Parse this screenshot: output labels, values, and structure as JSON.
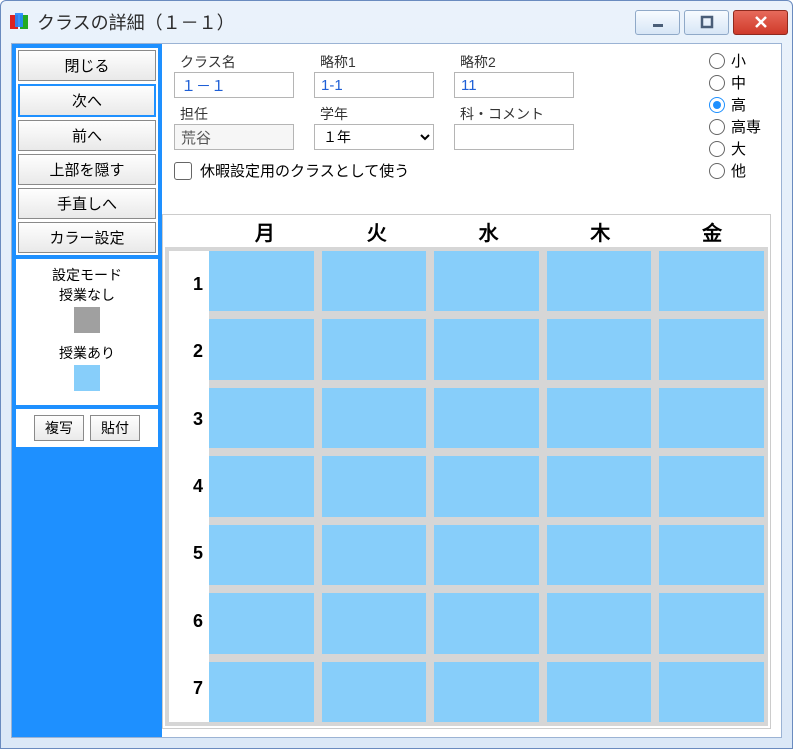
{
  "window": {
    "title": "クラスの詳細（１－１）"
  },
  "sidebar": {
    "buttons": {
      "close": "閉じる",
      "next": "次へ",
      "prev": "前へ",
      "hide_top": "上部を隠す",
      "rework": "手直しへ",
      "color": "カラー設定"
    },
    "mode": {
      "title": "設定モード",
      "no_class": "授業なし",
      "has_class": "授業あり"
    },
    "copy": "複写",
    "paste": "貼付"
  },
  "form": {
    "class_name_label": "クラス名",
    "class_name": "１－１",
    "abbr1_label": "略称1",
    "abbr1": "1-1",
    "abbr2_label": "略称2",
    "abbr2": "11",
    "teacher_label": "担任",
    "teacher": "荒谷",
    "grade_label": "学年",
    "grade": "１年",
    "dept_label": "科・コメント",
    "dept": "",
    "vacation_checkbox": "休暇設定用のクラスとして使う"
  },
  "school_levels": {
    "options": [
      "小",
      "中",
      "高",
      "高専",
      "大",
      "他"
    ],
    "selected": "高"
  },
  "timetable": {
    "days": [
      "月",
      "火",
      "水",
      "木",
      "金"
    ],
    "periods": [
      "1",
      "2",
      "3",
      "4",
      "5",
      "6",
      "7"
    ]
  }
}
